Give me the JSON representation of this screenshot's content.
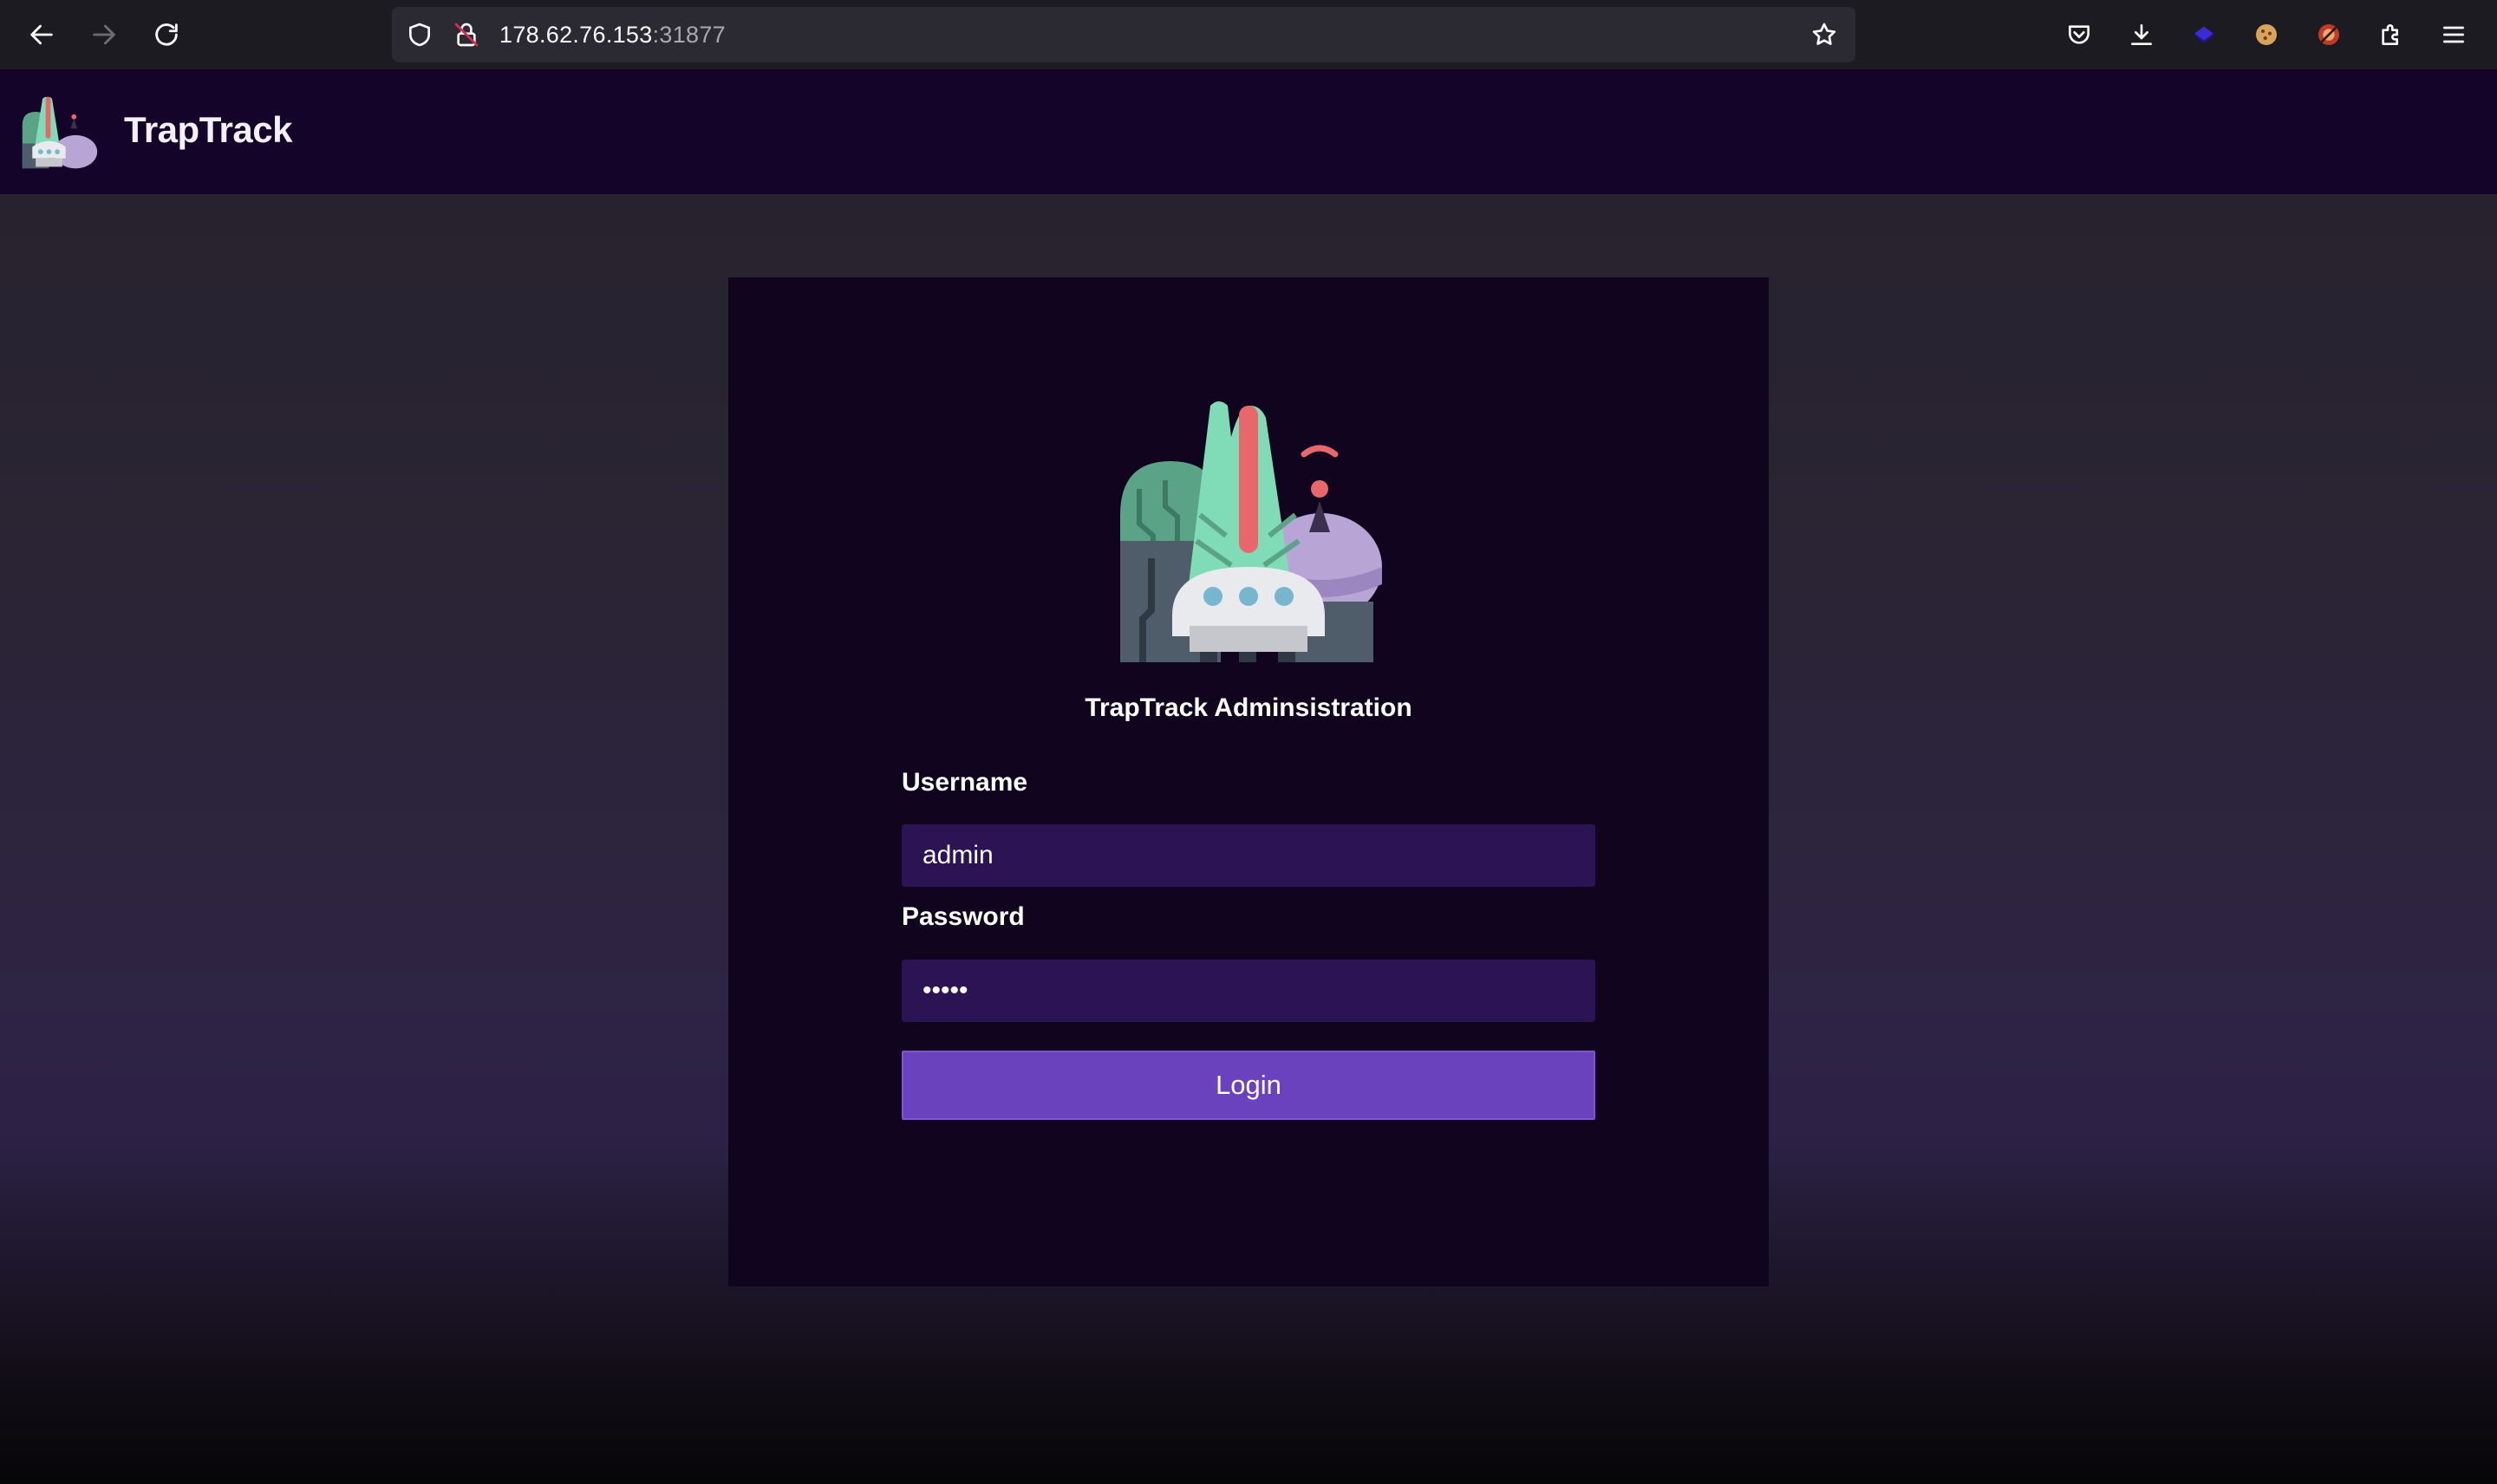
{
  "browser": {
    "url_host": "178.62.76.153",
    "url_port": ":31877"
  },
  "header": {
    "brand_name": "TrapTrack"
  },
  "login": {
    "title": "TrapTrack Adminsistration",
    "username_label": "Username",
    "username_value": "admin",
    "password_label": "Password",
    "password_value": "•••••",
    "login_label": "Login"
  },
  "colors": {
    "header_bg": "#14042a",
    "card_bg": "#10041f",
    "input_bg": "#2c1354",
    "button_bg": "#6b42bd"
  },
  "icons": [
    "back-icon",
    "forward-icon",
    "reload-icon",
    "shield-icon",
    "insecure-lock-icon",
    "bookmark-star-icon",
    "pocket-icon",
    "download-icon",
    "extension-icon",
    "cookie-icon",
    "extension-icon",
    "puzzle-icon",
    "menu-icon"
  ]
}
